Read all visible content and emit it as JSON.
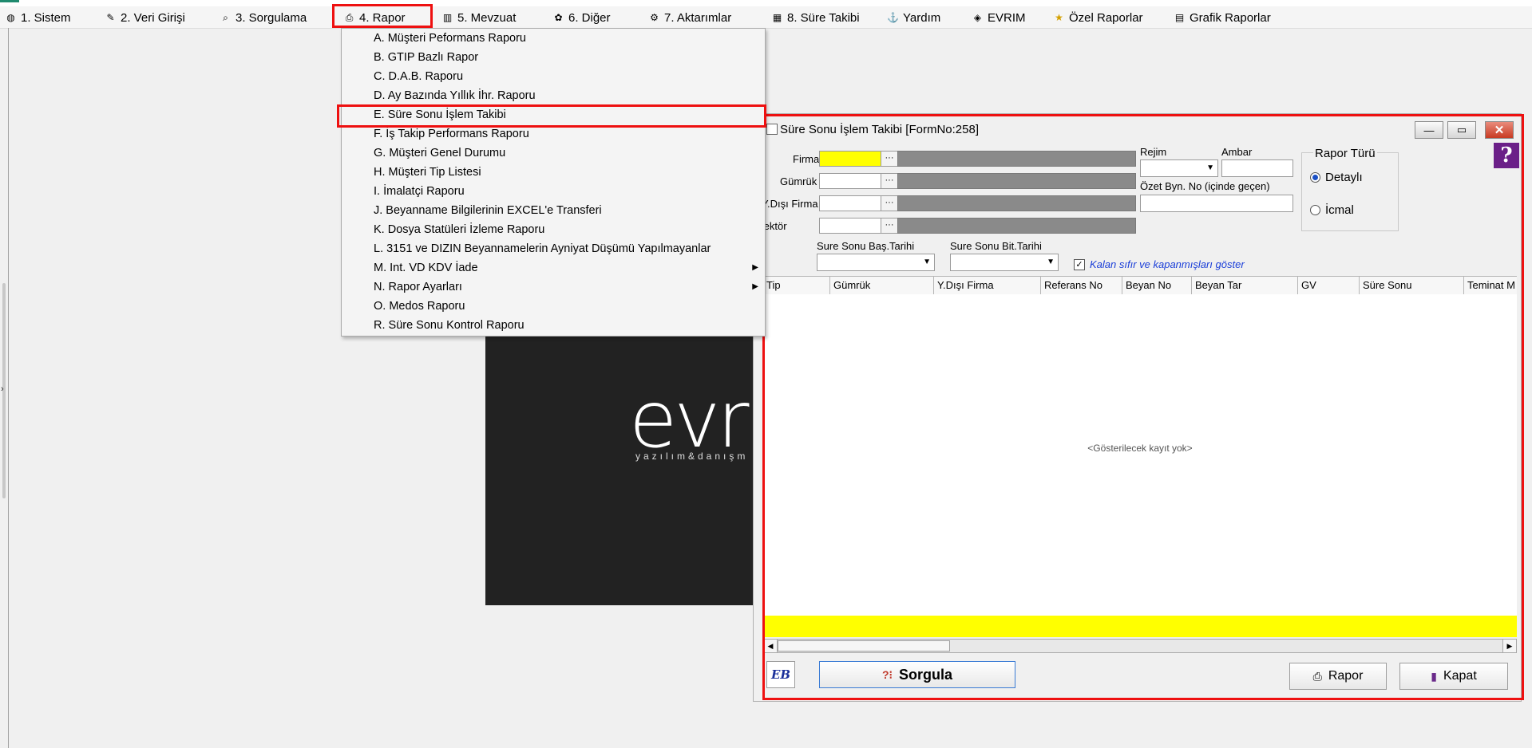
{
  "menubar": {
    "items": [
      {
        "label": "1.  Sistem",
        "icon": "system-icon"
      },
      {
        "label": "2.  Veri Girişi",
        "icon": "data-entry-icon"
      },
      {
        "label": "3.  Sorgulama",
        "icon": "query-icon"
      },
      {
        "label": "4.  Rapor",
        "icon": "report-icon"
      },
      {
        "label": "5.  Mevzuat",
        "icon": "legislation-icon"
      },
      {
        "label": "6.  Diğer",
        "icon": "other-icon"
      },
      {
        "label": "7.  Aktarımlar",
        "icon": "transfer-icon"
      },
      {
        "label": "8. Süre Takibi",
        "icon": "calendar-icon"
      },
      {
        "label": "Yardım",
        "icon": "help-icon"
      },
      {
        "label": "EVRIM",
        "icon": "book-icon"
      },
      {
        "label": "Özel Raporlar",
        "icon": "star-icon"
      },
      {
        "label": "Grafik Raporlar",
        "icon": "chart-icon"
      }
    ]
  },
  "dropdown": {
    "items": [
      {
        "label": "A.   Müşteri Peformans Raporu"
      },
      {
        "label": "B.   GTIP Bazlı Rapor"
      },
      {
        "label": "C.   D.A.B. Raporu"
      },
      {
        "label": "D.    Ay Bazında Yıllık İhr. Raporu"
      },
      {
        "label": "E.   Süre Sonu İşlem Takibi"
      },
      {
        "label": "F.   İş Takip Performans Raporu"
      },
      {
        "label": "G.   Müşteri Genel Durumu"
      },
      {
        "label": "H.   Müşteri Tip Listesi"
      },
      {
        "label": "I.   İmalatçi Raporu"
      },
      {
        "label": "J.   Beyanname Bilgilerinin EXCEL'e Transferi"
      },
      {
        "label": "K.   Dosya Statüleri İzleme Raporu"
      },
      {
        "label": "L.  3151 ve DIZIN Beyannamelerin Ayniyat Düşümü Yapılmayanlar"
      },
      {
        "label": "M. Int. VD KDV İade"
      },
      {
        "label": "N.   Rapor Ayarları"
      },
      {
        "label": "O. Medos Raporu"
      },
      {
        "label": "R.   Süre Sonu Kontrol Raporu"
      }
    ]
  },
  "splash": {
    "logo": "evri",
    "tagline": "yazılım&danışm"
  },
  "form": {
    "title": "Süre Sonu İşlem Takibi [FormNo:258]",
    "labels": {
      "firma": "Firma",
      "gumruk": "Gümrük",
      "ydisi": "Y.Dışı Firma",
      "sektor": "Sektör",
      "rejim": "Rejim",
      "ambar": "Ambar",
      "ozet": "Özet Byn. No (içinde geçen)",
      "bas": "Sure Sonu Baş.Tarihi",
      "bit": "Sure Sonu Bit.Tarihi"
    },
    "dots": "···",
    "rapor_turu": {
      "legend": "Rapor Türü",
      "options": [
        "Detaylı",
        "İcmal"
      ],
      "selected": "Detaylı"
    },
    "checkbox": {
      "label": "Kalan sıfır ve kapanmışları göster",
      "checked": true,
      "mark": "✓"
    },
    "columns": [
      "Tip",
      "Gümrük",
      "Y.Dışı Firma",
      "Referans No",
      "Beyan No",
      "Beyan Tar",
      "GV",
      "Süre Sonu",
      "Teminat M"
    ],
    "empty_text": "<Gösterilecek kayıt yok>",
    "buttons": {
      "sorgula": "Sorgula",
      "rapor": "Rapor",
      "kapat": "Kapat",
      "eb": "EB"
    }
  },
  "colors": {
    "highlight": "#ee1010",
    "field_yellow": "#ffff00",
    "splash_bg": "#222222"
  }
}
